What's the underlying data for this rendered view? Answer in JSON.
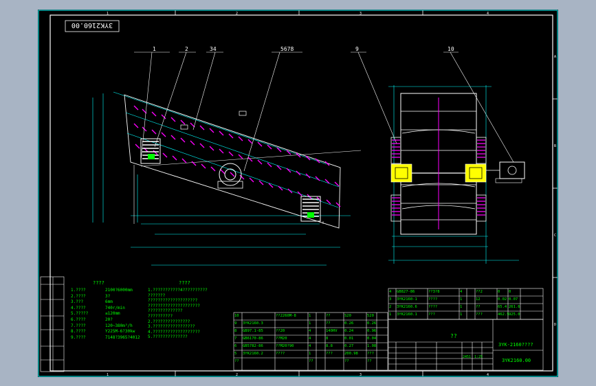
{
  "title_block_top": "3YK2160.00",
  "border_refs": {
    "top": [
      "1",
      "2",
      "3",
      "4"
    ],
    "bottom": [
      "1",
      "2",
      "3",
      "4"
    ],
    "right": [
      "A",
      "B",
      "C",
      "D"
    ]
  },
  "part_balloons": {
    "b1": "1",
    "b2": "2",
    "b34": "34",
    "b5678": "5678",
    "b9": "9",
    "b10": "10"
  },
  "tech_params": {
    "heading": "????",
    "rows": [
      {
        "label": "1.????",
        "value": "2100?6000mm"
      },
      {
        "label": "2.????",
        "value": "3?"
      },
      {
        "label": "3.???",
        "value": "6mm"
      },
      {
        "label": "4.????",
        "value": "740r/min"
      },
      {
        "label": "5.?????",
        "value": "≤120mm"
      },
      {
        "label": "6.????",
        "value": "20?"
      },
      {
        "label": "7.????",
        "value": "120~380m³/h"
      },
      {
        "label": "8.????",
        "value": "Y225M-6?30kw"
      },
      {
        "label": "9.????",
        "value": "7148?3965?4012"
      }
    ]
  },
  "tech_requirements": {
    "heading": "????",
    "lines": [
      "1.???????????4??????????",
      "  ???????",
      "  ????????????????????",
      "  ?????????????????????",
      "  ??????????????",
      "  ??????????",
      "2.???????????????",
      "3.?????????????????",
      "4.???????????????????",
      "5.??????????????"
    ]
  },
  "bom_left": [
    [
      "10",
      "",
      "??2260M-8",
      "1",
      "",
      "??",
      "S20",
      "520"
    ],
    [
      "9",
      "3YK2160.3",
      "",
      "1",
      "",
      "??",
      "0.26",
      "0.26"
    ],
    [
      "8",
      "GB97.1-85",
      "??20",
      "4",
      "",
      "140HV",
      "0.24",
      "0.96"
    ],
    [
      "7",
      "GB6170-86",
      "??M20",
      "4",
      "",
      "8",
      "0.01",
      "0.04"
    ],
    [
      "6",
      "GB5782-86",
      "??M20?90",
      "4",
      "",
      "8.8",
      "0.27",
      "1.08"
    ],
    [
      "5",
      "3YK2160.2",
      "????",
      "1",
      "",
      "???",
      "200.98",
      "???"
    ]
  ],
  "bom_left_header": [
    "??",
    "",
    "",
    "??",
    "",
    "",
    "??",
    "??"
  ],
  "bom_right": [
    [
      "4",
      "GB827-86",
      "??3?8",
      "4",
      "",
      "??2",
      "0",
      "0"
    ],
    [
      "3",
      "3YK2160-1",
      "????",
      "1",
      "",
      "12",
      "0.02",
      "0.07"
    ],
    [
      "2",
      "3YK2160.6",
      "????",
      "1",
      "",
      "??",
      "65.4",
      "261.6"
    ],
    [
      "1",
      "3YK2160.1",
      "???",
      "1",
      "",
      "???",
      "462.5",
      "925.0"
    ]
  ],
  "title_block": {
    "drawing_name": "??",
    "code_main": "3YK-2160????",
    "code_bottom": "3YK2160.00",
    "scale": "1:25",
    "sheet": "2451",
    "left_cells": [
      "??",
      "??",
      "??",
      "??",
      "??"
    ],
    "side_stack": [
      "???|??",
      "?|?",
      "?|?",
      "??|?",
      "?|?",
      "?|?"
    ]
  },
  "colors": {
    "frame": "#00ffff",
    "detail": "#ff00ff",
    "text": "#00ff00",
    "motor": "#ffff00",
    "sheet": "#000000",
    "margin": "#a8b4c4"
  }
}
